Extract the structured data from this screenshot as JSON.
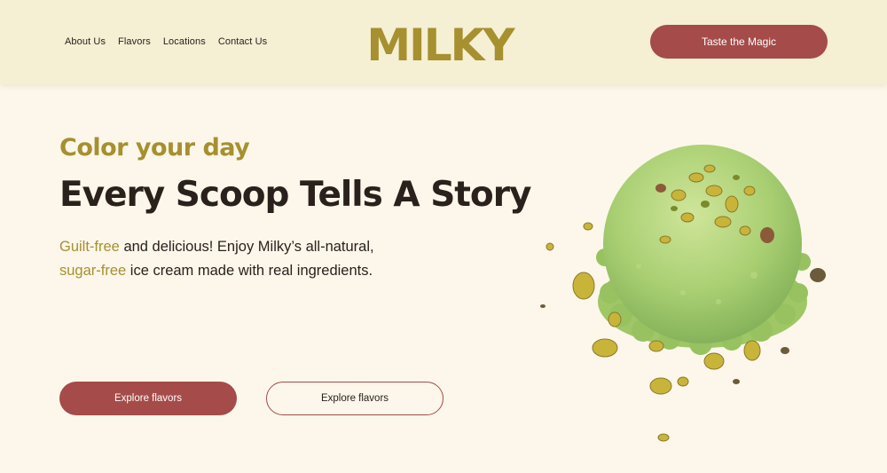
{
  "nav": {
    "items": [
      {
        "label": "About Us"
      },
      {
        "label": "Flavors"
      },
      {
        "label": "Locations"
      },
      {
        "label": "Contact Us"
      }
    ]
  },
  "logo": {
    "text": "MILKY",
    "color": "#a6902f"
  },
  "header": {
    "cta_label": "Taste the Magic"
  },
  "hero": {
    "eyebrow": "Color your day",
    "headline": "Every Scoop Tells A Story",
    "description": {
      "highlight_1": "Guilt-free",
      "text_1": " and delicious! Enjoy Milky’s all-natural,",
      "highlight_2": "sugar-free",
      "text_2": " ice cream made with real ingredients."
    },
    "primary_button": "Explore flavors",
    "secondary_button": "Explore flavors"
  },
  "colors": {
    "accent": "#a6902f",
    "brand": "#a54b49",
    "background": "#fcf7ea",
    "header_background": "#f5efd4",
    "text": "#2a211c"
  },
  "image": {
    "icon": "pistachio-ice-cream-scoop"
  }
}
